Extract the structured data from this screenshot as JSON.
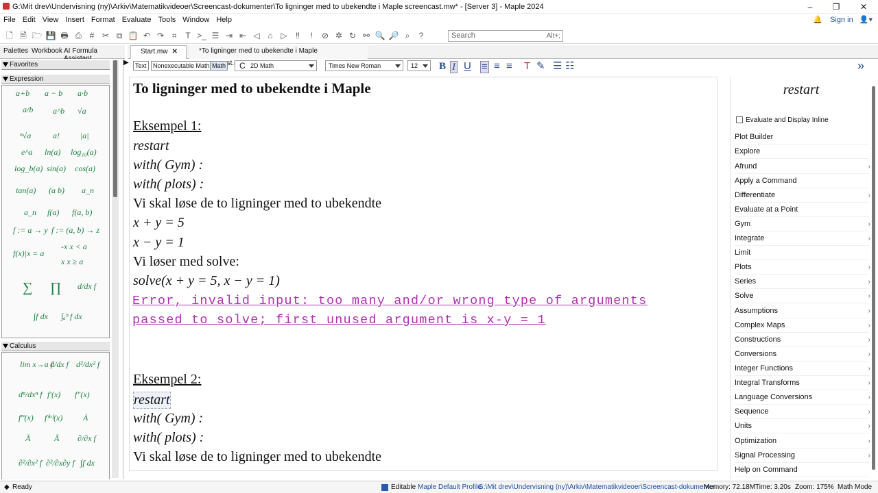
{
  "window": {
    "title": "G:\\Mit drev\\Undervisning (ny)\\Arkiv\\Matematikvideoer\\Screencast-dokumenter\\To ligninger med to ubekendte i Maple screencast.mw* - [Server 3] - Maple 2024",
    "minimize": "–",
    "maximize": "❐",
    "close": "✕"
  },
  "menu": {
    "items": [
      "File",
      "Edit",
      "View",
      "Insert",
      "Format",
      "Evaluate",
      "Tools",
      "Window",
      "Help"
    ],
    "signin": "Sign in"
  },
  "search": {
    "placeholder": "Search",
    "shortcut": "Alt+;"
  },
  "left_tabs": [
    "Palettes",
    "Workbook",
    "AI Formula Assistant"
  ],
  "palettes": {
    "favorites": "Favorites",
    "expression": "Expression",
    "calculus": "Calculus",
    "expression_items": [
      "a+b",
      "a − b",
      "a·b",
      "a/b",
      "a^b",
      "√a",
      "ⁿ√a",
      "a!",
      "|a|",
      "e^a",
      "ln(a)",
      "log₁₀(a)",
      "log_b(a)",
      "sin(a)",
      "cos(a)",
      "tan(a)",
      "(a b)",
      "a_n",
      "a_n",
      "f(a)",
      "f(a, b)",
      "f := a → y",
      "f := (a, b) → z",
      "f(x)|x = a",
      "-x  x < a",
      "x  x ≥ a",
      "∑",
      "∏",
      "d/dx f",
      "∫f dx",
      "∫ₐᵇ f dx"
    ],
    "calculus_items": [
      "lim x→a f",
      "d/dx f",
      "d²/dx² f",
      "dⁿ/dxⁿ f",
      "f′(x)",
      "f″(x)",
      "f‴(x)",
      "f⁽ⁿ⁾(x)",
      "Ȧ",
      "Ä",
      "Ä",
      "∂/∂x f",
      "∂²/∂x² f",
      "∂²/∂x∂y f",
      "∫f dx"
    ]
  },
  "doc_tabs": [
    {
      "label": "Start.mw"
    },
    {
      "label": "*To ligninger med to ubekendte i Maple screencast.mw"
    }
  ],
  "format_bar": {
    "text": "Text",
    "nonexec": "Nonexecutable Math",
    "math": "Math",
    "mode": "2D Math",
    "font": "Times New Roman",
    "size": "12"
  },
  "document": {
    "title": "To ligninger med to ubekendte i Maple",
    "ex1_heading": "Eksempel 1:",
    "ex1_restart": "restart",
    "ex1_gym": "with( Gym) :",
    "ex1_plots": "with( plots) :",
    "ex1_text": "Vi skal løse de to ligninger med to ubekendte",
    "eq1": "x + y = 5",
    "eq2": "x − y = 1",
    "solve_text": "Vi løser med solve:",
    "solve_cmd": "solve(x + y = 5, x − y = 1)",
    "error_line1": "Error, invalid input: too many and/or wrong type of arguments",
    "error_line2": "passed to solve; first unused argument is x-y = 1",
    "ex2_heading": "Eksempel 2:",
    "ex2_restart": "restart",
    "ex2_gym": "with( Gym) :",
    "ex2_plots": "with( plots) :",
    "ex2_text": "Vi skal løse de to ligninger med to ubekendte"
  },
  "context_panel": {
    "title": "restart",
    "inline_label": "Evaluate and Display Inline",
    "items": [
      {
        "label": "Plot Builder",
        "submenu": false
      },
      {
        "label": "Explore",
        "submenu": false
      },
      {
        "label": "Afrund",
        "submenu": true
      },
      {
        "label": "Apply a Command",
        "submenu": false
      },
      {
        "label": "Differentiate",
        "submenu": true
      },
      {
        "label": "Evaluate at a Point",
        "submenu": false
      },
      {
        "label": "Gym",
        "submenu": true
      },
      {
        "label": "Integrate",
        "submenu": true
      },
      {
        "label": "Limit",
        "submenu": false
      },
      {
        "label": "Plots",
        "submenu": true
      },
      {
        "label": "Series",
        "submenu": true
      },
      {
        "label": "Solve",
        "submenu": true
      },
      {
        "label": "Assumptions",
        "submenu": true
      },
      {
        "label": "Complex Maps",
        "submenu": true
      },
      {
        "label": "Constructions",
        "submenu": true
      },
      {
        "label": "Conversions",
        "submenu": true
      },
      {
        "label": "Integer Functions",
        "submenu": true
      },
      {
        "label": "Integral Transforms",
        "submenu": true
      },
      {
        "label": "Language Conversions",
        "submenu": true
      },
      {
        "label": "Sequence",
        "submenu": true
      },
      {
        "label": "Units",
        "submenu": true
      },
      {
        "label": "Optimization",
        "submenu": true
      },
      {
        "label": "Signal Processing",
        "submenu": true
      },
      {
        "label": "Help on Command",
        "submenu": false
      }
    ]
  },
  "status": {
    "ready": "Ready",
    "editable": "Editable",
    "profile": "Maple Default Profile",
    "path": "G:\\Mit drev\\Undervisning (ny)\\Arkiv\\Matematikvideoer\\Screencast-dokumenter",
    "memory": "Memory: 72.18M",
    "time": "Time: 3.20s",
    "zoom": "Zoom: 175%",
    "mode": "Math Mode"
  },
  "colors": {
    "error": "#b030b0",
    "palette_symbol": "#1a7f3f",
    "accent": "#1b4fa3"
  }
}
